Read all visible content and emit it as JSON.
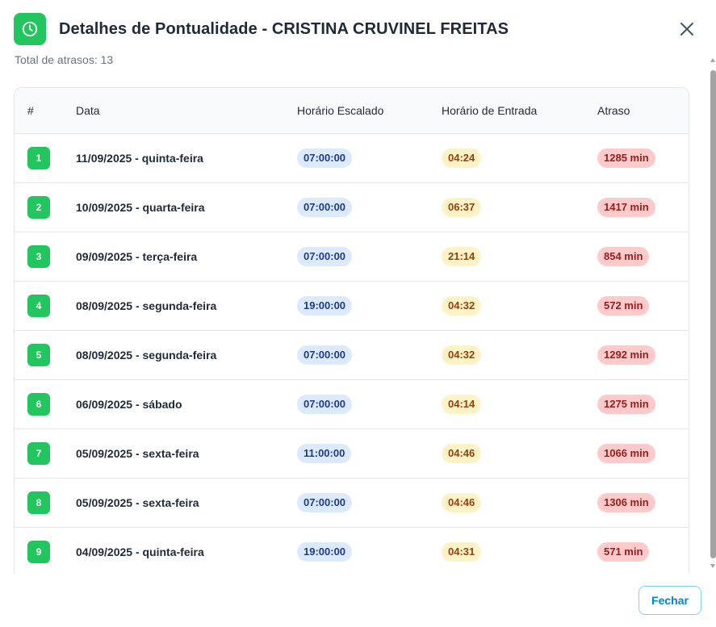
{
  "header": {
    "title": "Detalhes de Pontualidade - CRISTINA CRUVINEL FREITAS",
    "icon": "clock-icon",
    "close_icon": "close-icon"
  },
  "summary": {
    "total_delays_text": "Total de atrasos: 13"
  },
  "table": {
    "columns": [
      "#",
      "Data",
      "Horário Escalado",
      "Horário de Entrada",
      "Atraso"
    ],
    "rows": [
      {
        "num": "1",
        "date": "11/09/2025 - quinta-feira",
        "scheduled": "07:00:00",
        "entry": "04:24",
        "delay": "1285 min"
      },
      {
        "num": "2",
        "date": "10/09/2025 - quarta-feira",
        "scheduled": "07:00:00",
        "entry": "06:37",
        "delay": "1417 min"
      },
      {
        "num": "3",
        "date": "09/09/2025 - terça-feira",
        "scheduled": "07:00:00",
        "entry": "21:14",
        "delay": "854 min"
      },
      {
        "num": "4",
        "date": "08/09/2025 - segunda-feira",
        "scheduled": "19:00:00",
        "entry": "04:32",
        "delay": "572 min"
      },
      {
        "num": "5",
        "date": "08/09/2025 - segunda-feira",
        "scheduled": "07:00:00",
        "entry": "04:32",
        "delay": "1292 min"
      },
      {
        "num": "6",
        "date": "06/09/2025 - sábado",
        "scheduled": "07:00:00",
        "entry": "04:14",
        "delay": "1275 min"
      },
      {
        "num": "7",
        "date": "05/09/2025 - sexta-feira",
        "scheduled": "11:00:00",
        "entry": "04:46",
        "delay": "1066 min"
      },
      {
        "num": "8",
        "date": "05/09/2025 - sexta-feira",
        "scheduled": "07:00:00",
        "entry": "04:46",
        "delay": "1306 min"
      },
      {
        "num": "9",
        "date": "04/09/2025 - quinta-feira",
        "scheduled": "19:00:00",
        "entry": "04:31",
        "delay": "571 min"
      }
    ]
  },
  "footer": {
    "close_label": "Fechar"
  },
  "colors": {
    "accent_green": "#22c55e",
    "scheduled_pill": "#dbeafe",
    "entry_pill": "#fef3c7",
    "delay_pill": "#fecaca",
    "button_border": "#7dd3fc"
  }
}
